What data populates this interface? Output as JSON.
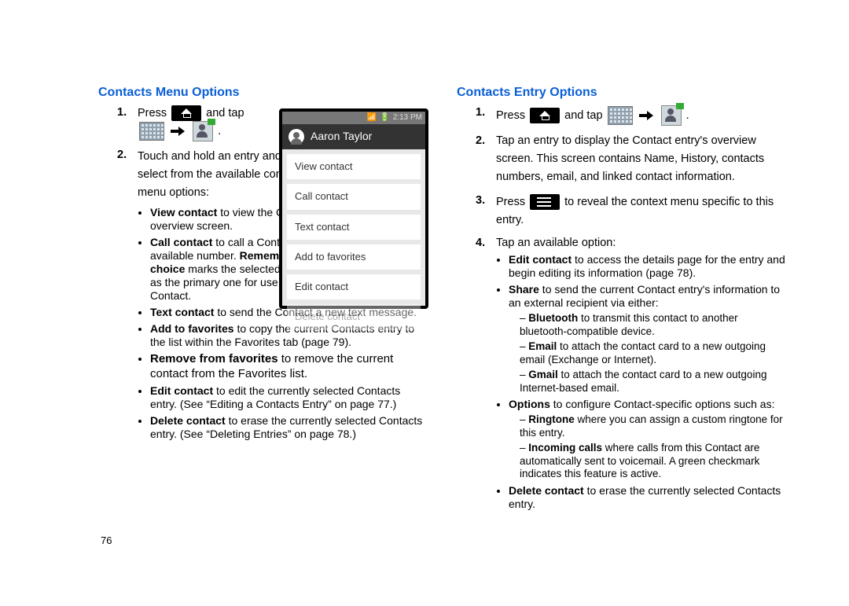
{
  "page_number": "76",
  "left": {
    "heading": "Contacts Menu Options",
    "step1_press": "Press",
    "step1_andtap": "and tap",
    "step2": "Touch and hold an entry and select from the available contact menu options:",
    "b_view": {
      "lead": "View contact",
      "rest": " to view the Contact's overview screen."
    },
    "b_call": {
      "lead": "Call contact",
      "rest": " to call a Contact's available number. ",
      "lead2": "Remember this choice",
      "rest2": " marks the selected number as the primary one for use with this Contact."
    },
    "b_text": {
      "lead": "Text contact",
      "rest": " to send the Contact a new text message."
    },
    "b_addfav": {
      "lead": "Add to favorites",
      "rest": " to copy the current Contacts entry to the list within the Favorites tab (page 79)."
    },
    "b_remfav": {
      "lead": "Remove from favorites",
      "rest": " to remove the current contact from the Favorites list."
    },
    "b_edit": {
      "lead": "Edit contact",
      "rest": " to edit the currently selected Contacts entry. (See “Editing a Contacts Entry” on page 77.)"
    },
    "b_del": {
      "lead": "Delete contact",
      "rest": " to erase the currently selected Contacts entry. (See “Deleting Entries” on page 78.)"
    },
    "phone": {
      "time": "2:13 PM",
      "title": "Aaron Taylor",
      "items": [
        "View contact",
        "Call contact",
        "Text contact",
        "Add to favorites",
        "Edit contact",
        "Delete contact"
      ]
    }
  },
  "right": {
    "heading": "Contacts Entry Options",
    "s1_press": "Press",
    "s1_andtap": "and tap",
    "s2": "Tap an entry to display the Contact entry's overview screen. This screen contains Name, History, contacts numbers, email, and linked contact information.",
    "s3_press": "Press",
    "s3_rest": "to reveal the context menu specific to this entry.",
    "s4": "Tap an available option:",
    "b_edit": {
      "lead": "Edit contact",
      "rest": " to access the details page for the entry and begin editing its information (page 78)."
    },
    "b_share": {
      "lead": "Share",
      "rest": " to send the current Contact entry's information to an external recipient via either:"
    },
    "sh_bt": {
      "lead": "Bluetooth",
      "rest": " to transmit this contact to another bluetooth-compatible device."
    },
    "sh_em": {
      "lead": "Email",
      "rest": " to attach the contact card to a new outgoing email (Exchange or Internet)."
    },
    "sh_gm": {
      "lead": "Gmail",
      "rest": " to attach the contact card to a new outgoing Internet-based email."
    },
    "b_opts": {
      "lead": "Options",
      "rest": " to configure Contact-specific options such as:"
    },
    "op_rt": {
      "lead": "Ringtone",
      "rest": " where you can assign a custom ringtone for this entry."
    },
    "op_ic": {
      "lead": "Incoming calls",
      "rest": " where calls from this Contact are automatically sent to voicemail. A green checkmark indicates this feature is active."
    },
    "b_del": {
      "lead": "Delete contact",
      "rest": " to erase the currently selected Contacts entry."
    }
  }
}
